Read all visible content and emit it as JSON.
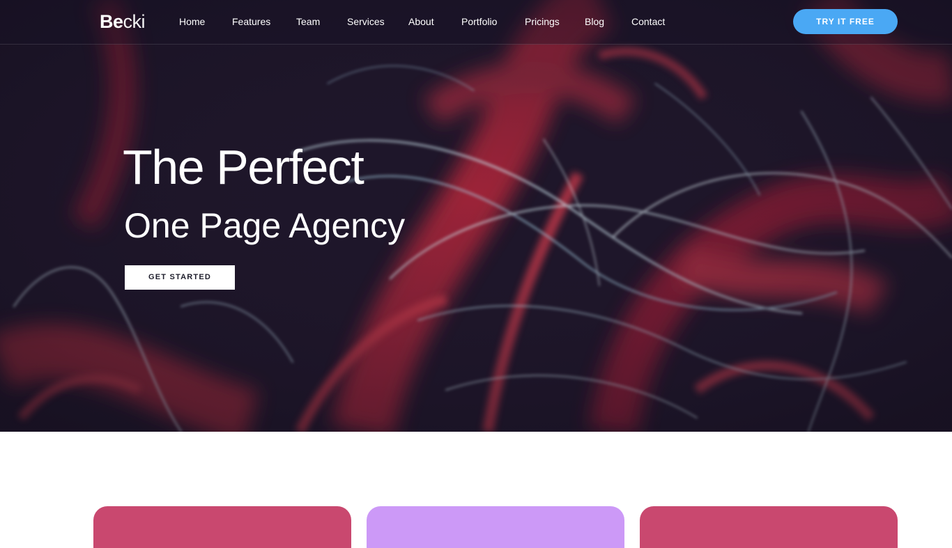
{
  "brand": {
    "logo_strong": "Be",
    "logo_light": "cki"
  },
  "nav": {
    "items": [
      {
        "label": "Home"
      },
      {
        "label": "Features"
      },
      {
        "label": "Team"
      },
      {
        "label": "Services"
      },
      {
        "label": "About"
      },
      {
        "label": "Portfolio"
      },
      {
        "label": "Pricings"
      },
      {
        "label": "Blog"
      },
      {
        "label": "Contact"
      }
    ],
    "cta_label": "TRY IT FREE"
  },
  "hero": {
    "line1": "The Perfect",
    "line2": "One Page Agency",
    "button_label": "GET STARTED"
  },
  "colors": {
    "accent_blue": "#4aa8f4",
    "card_pink": "#c9486f",
    "card_lavender": "#cc99f7",
    "hero_dark": "#1c1529"
  },
  "cards": [
    {
      "color": "#c9486f"
    },
    {
      "color": "#cc99f7"
    },
    {
      "color": "#c9486f"
    }
  ]
}
